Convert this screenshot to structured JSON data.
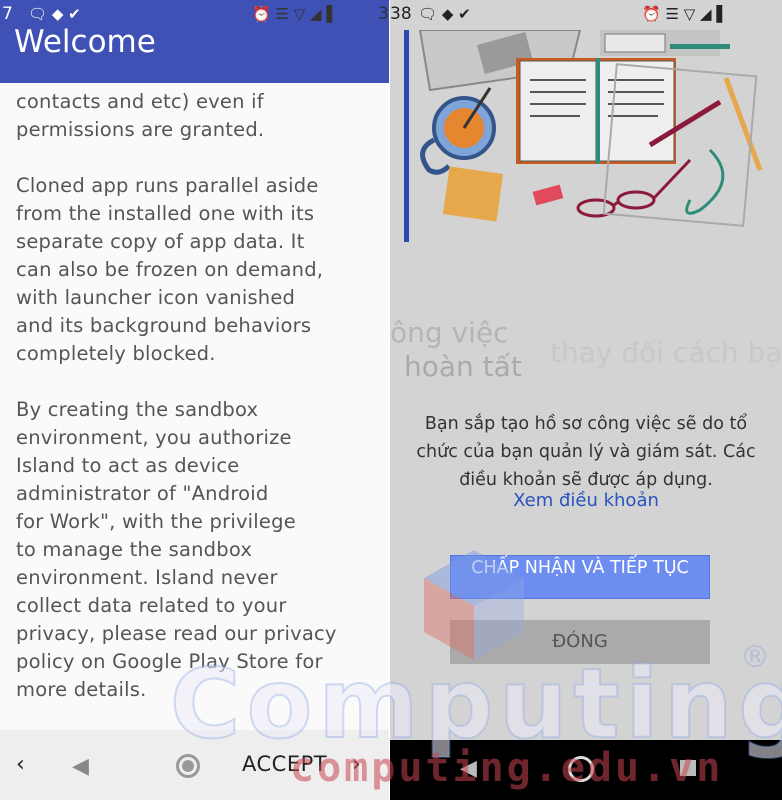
{
  "left_screen": {
    "status_bar": {
      "time_left": "7",
      "time_right": "38",
      "icons_left": [
        "messenger-icon",
        "shield-icon",
        "check-icon"
      ],
      "icons_right": [
        "alarm-icon",
        "vibrate-icon",
        "wifi-icon",
        "signal-icon",
        "battery-icon"
      ]
    },
    "app_bar": {
      "title": "Welcome",
      "color": "#3f51b5"
    },
    "paragraphs": [
      "contacts and etc) even if\npermissions are granted.",
      "Cloned app runs parallel aside\nfrom the installed one with its\nseparate copy of app data. It\ncan also be frozen on demand,\nwith launcher icon vanished\nand its background behaviors\ncompletely blocked.",
      "By creating the sandbox\nenvironment, you authorize\nIsland to act as device\nadministrator of \"Android\nfor Work\", with the privilege\nto manage the sandbox\nenvironment. Island never\ncollect data related to your\nprivacy, please read our privacy\npolicy on Google Play Store for\nmore details."
    ],
    "bottom_bar": {
      "prev": "‹",
      "accept_label": "ACCEPT",
      "next": "›"
    }
  },
  "right_screen": {
    "status_bar": {
      "time": "38",
      "icons_left": [
        "messenger-icon",
        "shield-icon",
        "check-icon"
      ],
      "icons_right": [
        "alarm-icon",
        "vibrate-icon",
        "wifi-icon",
        "signal-icon",
        "battery-icon"
      ]
    },
    "ghost_text": {
      "line1": "ông việc",
      "line2": "hoàn tất",
      "line3": "thay đổi cách bạn là"
    },
    "info_text": "Bạn sắp tạo hồ sơ công việc sẽ do tổ chức của bạn quản lý và giám sát. Các điều khoản sẽ được áp dụng.",
    "terms_link": "Xem điều khoản",
    "accept_button": "CHẤP NHẬN VÀ TIẾP TỤC",
    "close_button": "ĐÓNG",
    "accent": "#6d8ef0"
  },
  "watermark": {
    "brand": "Computing",
    "registered": "®",
    "url": "computing.edu.vn"
  }
}
